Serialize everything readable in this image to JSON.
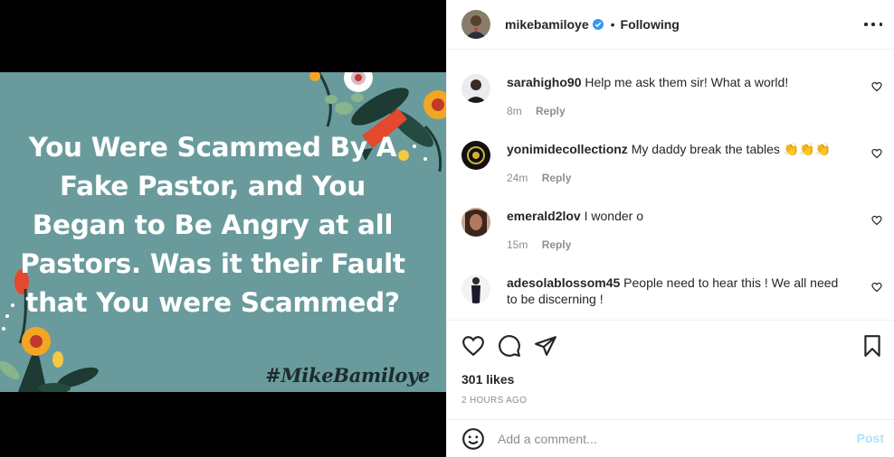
{
  "post": {
    "image_text_lines": [
      "You Were Scammed By A",
      "Fake Pastor, and You",
      "Began to Be Angry at all",
      "Pastors. Was it their Fault",
      "that You were Scammed?"
    ],
    "hashtag": "#MikeBamiloye",
    "background_color": "#6a9b9c"
  },
  "header": {
    "username": "mikebamiloye",
    "verified_icon": "verified-badge-icon",
    "separator": "•",
    "follow_status": "Following",
    "more_icon": "more-options-icon"
  },
  "comments": [
    {
      "username": "sarahigho90",
      "text": "Help me ask them sir! What a world!",
      "time": "8m",
      "reply": "Reply"
    },
    {
      "username": "yonimidecollectionz",
      "text": "My daddy break the tables 👏👏👏",
      "time": "24m",
      "reply": "Reply"
    },
    {
      "username": "emerald2lov",
      "text": "I wonder o",
      "time": "15m",
      "reply": "Reply"
    },
    {
      "username": "adesolablossom45",
      "text": "People need to hear this ! We all need to be discerning !",
      "time": "",
      "reply": ""
    }
  ],
  "actions": {
    "like_icon": "heart-icon",
    "comment_icon": "comment-bubble-icon",
    "share_icon": "paper-plane-icon",
    "save_icon": "bookmark-icon",
    "likes": "301 likes",
    "posted": "2 HOURS AGO"
  },
  "composer": {
    "emoji_icon": "smiley-icon",
    "placeholder": "Add a comment...",
    "post_label": "Post",
    "post_color": "#b2dffc"
  }
}
